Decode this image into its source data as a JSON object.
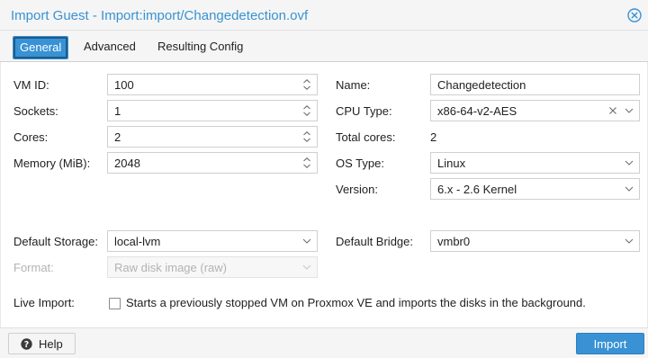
{
  "dialog": {
    "title": "Import Guest - Import:import/Changedetection.ovf"
  },
  "tabs": [
    {
      "label": "General",
      "active": true
    },
    {
      "label": "Advanced",
      "active": false
    },
    {
      "label": "Resulting Config",
      "active": false
    }
  ],
  "form": {
    "vmid": {
      "label": "VM ID:",
      "value": "100"
    },
    "sockets": {
      "label": "Sockets:",
      "value": "1"
    },
    "cores": {
      "label": "Cores:",
      "value": "2"
    },
    "memory": {
      "label": "Memory (MiB):",
      "value": "2048"
    },
    "name": {
      "label": "Name:",
      "value": "Changedetection"
    },
    "cpu_type": {
      "label": "CPU Type:",
      "value": "x86-64-v2-AES"
    },
    "total_cores": {
      "label": "Total cores:",
      "value": "2"
    },
    "os_type": {
      "label": "OS Type:",
      "value": "Linux"
    },
    "version": {
      "label": "Version:",
      "value": "6.x - 2.6 Kernel"
    },
    "default_storage": {
      "label": "Default Storage:",
      "value": "local-lvm"
    },
    "default_bridge": {
      "label": "Default Bridge:",
      "value": "vmbr0"
    },
    "format": {
      "label": "Format:",
      "value": "Raw disk image (raw)",
      "disabled": true
    },
    "live_import": {
      "label": "Live Import:",
      "checked": false,
      "description": "Starts a previously stopped VM on Proxmox VE and imports the disks in the background."
    }
  },
  "footer": {
    "help_label": "Help",
    "import_label": "Import"
  },
  "colors": {
    "accent": "#3892d4",
    "disabled_text": "#b3b3b3",
    "header_bg": "#f5f5f5"
  },
  "icons": {
    "close": "close-circle-icon",
    "spinner": "spinner-up-down-icon",
    "dropdown": "chevron-down-icon",
    "clear": "clear-x-icon",
    "help": "question-circle-icon"
  }
}
